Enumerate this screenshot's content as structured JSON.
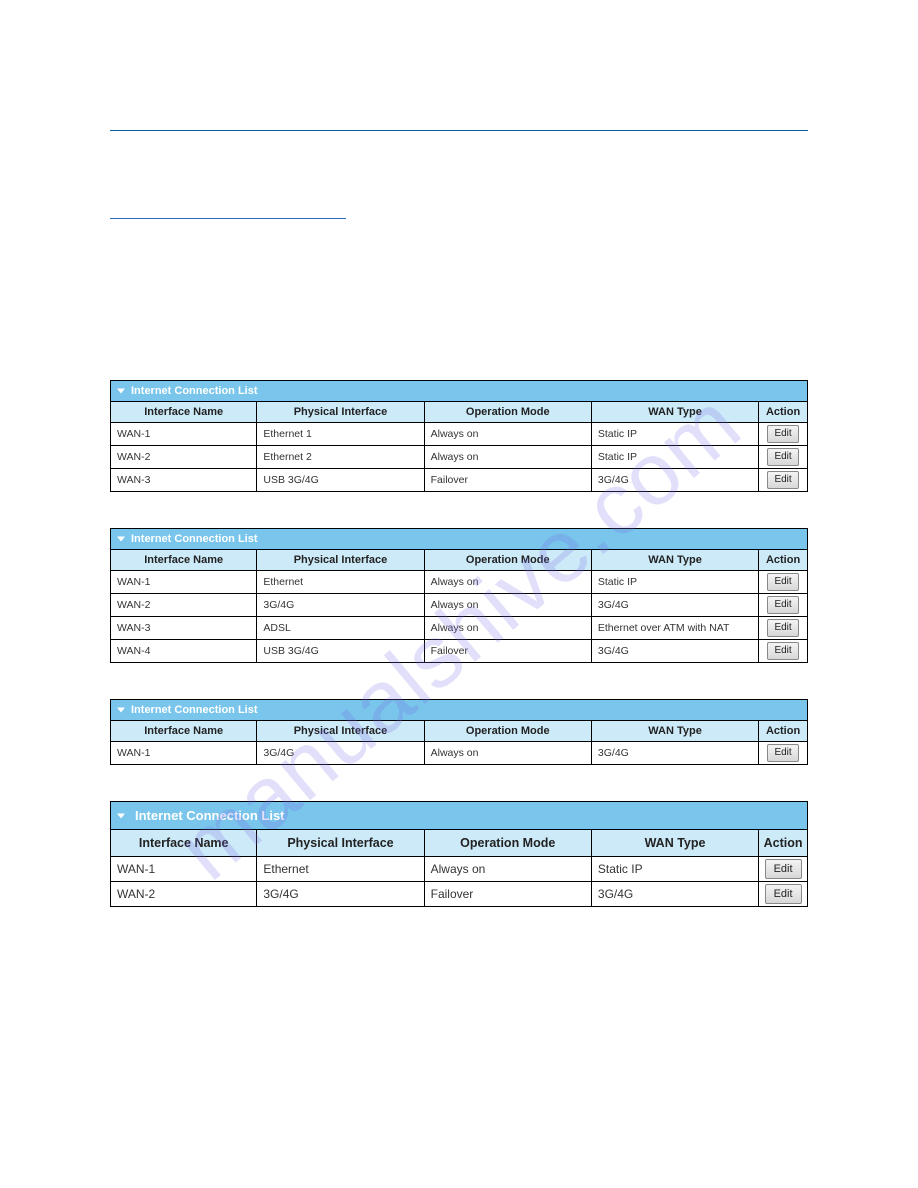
{
  "watermark": "manualshive.com",
  "captions": {
    "table": "Internet Connection List"
  },
  "headers": {
    "iface": "Interface Name",
    "phys": "Physical Interface",
    "op": "Operation Mode",
    "wan": "WAN Type",
    "action": "Action"
  },
  "buttons": {
    "edit": "Edit"
  },
  "tables": [
    {
      "rows": [
        {
          "iface": "WAN-1",
          "phys": "Ethernet 1",
          "op": "Always on",
          "wan": "Static IP"
        },
        {
          "iface": "WAN-2",
          "phys": "Ethernet 2",
          "op": "Always on",
          "wan": "Static IP"
        },
        {
          "iface": "WAN-3",
          "phys": "USB 3G/4G",
          "op": "Failover",
          "wan": "3G/4G"
        }
      ]
    },
    {
      "rows": [
        {
          "iface": "WAN-1",
          "phys": "Ethernet",
          "op": "Always on",
          "wan": "Static IP"
        },
        {
          "iface": "WAN-2",
          "phys": "3G/4G",
          "op": "Always on",
          "wan": "3G/4G"
        },
        {
          "iface": "WAN-3",
          "phys": "ADSL",
          "op": "Always on",
          "wan": "Ethernet over ATM with NAT"
        },
        {
          "iface": "WAN-4",
          "phys": "USB 3G/4G",
          "op": "Failover",
          "wan": "3G/4G"
        }
      ]
    },
    {
      "rows": [
        {
          "iface": "WAN-1",
          "phys": "3G/4G",
          "op": "Always on",
          "wan": "3G/4G"
        }
      ]
    },
    {
      "rows": [
        {
          "iface": "WAN-1",
          "phys": "Ethernet",
          "op": "Always on",
          "wan": "Static IP"
        },
        {
          "iface": "WAN-2",
          "phys": "3G/4G",
          "op": "Failover",
          "wan": "3G/4G"
        }
      ]
    }
  ]
}
